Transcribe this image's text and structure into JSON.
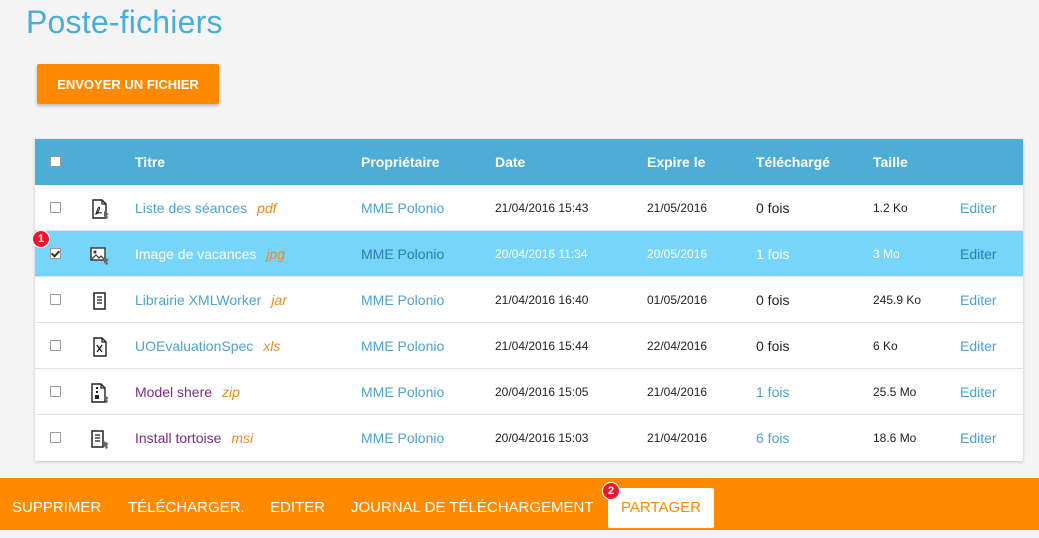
{
  "page": {
    "title": "Poste-fichiers",
    "upload_button": "ENVOYER UN FICHIER"
  },
  "table": {
    "headers": {
      "title": "Titre",
      "owner": "Propriétaire",
      "date": "Date",
      "expires": "Expire le",
      "downloaded": "Téléchargé",
      "size": "Taille"
    },
    "rows": [
      {
        "icon": "pdf-file-icon",
        "title": "Liste des séances",
        "ext": "pdf",
        "owner": "MME Polonio",
        "date": "21/04/2016 15:43",
        "expires": "21/05/2016",
        "downloaded": "0 fois",
        "size": "1.2 Ko",
        "edit": "Editer",
        "checked": false
      },
      {
        "icon": "image-file-icon",
        "title": "Image de vacances",
        "ext": "jpg",
        "owner": "MME Polonio",
        "date": "20/04/2016 11:34",
        "expires": "20/05/2016",
        "downloaded": "1 fois",
        "size": "3 Mo",
        "edit": "Editer",
        "checked": true
      },
      {
        "icon": "text-file-icon",
        "title": "Librairie XMLWorker",
        "ext": "jar",
        "owner": "MME Polonio",
        "date": "21/04/2016 16:40",
        "expires": "01/05/2016",
        "downloaded": "0 fois",
        "size": "245.9 Ko",
        "edit": "Editer",
        "checked": false
      },
      {
        "icon": "excel-file-icon",
        "title": "UOEvaluationSpec",
        "ext": "xls",
        "owner": "MME Polonio",
        "date": "21/04/2016 15:44",
        "expires": "22/04/2016",
        "downloaded": "0 fois",
        "size": "6 Ko",
        "edit": "Editer",
        "checked": false
      },
      {
        "icon": "zip-file-icon",
        "title": "Model shere",
        "ext": "zip",
        "owner": "MME Polonio",
        "date": "20/04/2016 15:05",
        "expires": "21/04/2016",
        "downloaded": "1 fois",
        "size": "25.5 Mo",
        "edit": "Editer",
        "checked": false
      },
      {
        "icon": "text-file-icon",
        "title": "Install tortoise",
        "ext": "msi",
        "owner": "MME Polonio",
        "date": "20/04/2016 15:03",
        "expires": "21/04/2016",
        "downloaded": "6 fois",
        "size": "18.6 Mo",
        "edit": "Editer",
        "checked": false
      }
    ]
  },
  "badges": {
    "first": "1",
    "second": "2"
  },
  "actions": {
    "delete": "SUPPRIMER",
    "download": "TÉLÉCHARGER.",
    "edit": "EDITER",
    "log": "JOURNAL DE TÉLÉCHARGEMENT",
    "share": "PARTAGER"
  },
  "colors": {
    "accent_orange": "#ff8a00",
    "header_blue": "#4dadd6",
    "selected_row": "#77d5fa",
    "link_blue": "#4aa3d3",
    "badge_red": "#e8192c"
  }
}
